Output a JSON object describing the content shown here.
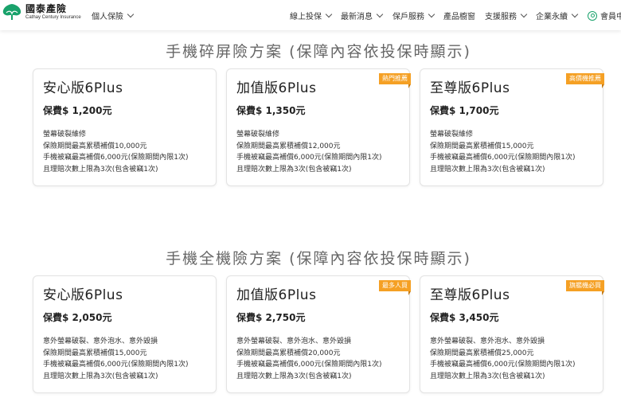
{
  "brand": {
    "name_cn": "國泰產險",
    "name_en": "Cathay Century Insurance",
    "primary_color": "#19a26b",
    "badge_color": "#f5a024"
  },
  "nav": {
    "personal": "個人保險",
    "items": [
      "線上投保",
      "最新消息",
      "保戶服務",
      "產品櫥窗",
      "支援服務",
      "企業永續"
    ],
    "member": "會員中心"
  },
  "sections": [
    {
      "title": "手機碎屏險方案 (保障內容依投保時顯示)",
      "plans": [
        {
          "name": "安心版6Plus",
          "badge": "",
          "price": "保費$ 1,200元",
          "lines": [
            "螢幕破裂維修",
            "保險期間最高累積補償10,000元",
            "手機被竊最高補償6,000元(保險期間內限1次)",
            "且理賠次數上限為3次(包含被竊1次)"
          ]
        },
        {
          "name": "加值版6Plus",
          "badge": "熱門推薦",
          "price": "保費$ 1,350元",
          "lines": [
            "螢幕破裂維修",
            "保險期間最高累積補償12,000元",
            "手機被竊最高補償6,000元(保險期間內限1次)",
            "且理賠次數上限為3次(包含被竊1次)"
          ]
        },
        {
          "name": "至尊版6Plus",
          "badge": "高價機推薦",
          "price": "保費$ 1,700元",
          "lines": [
            "螢幕破裂維修",
            "保險期間最高累積補償15,000元",
            "手機被竊最高補償6,000元(保險期間內限1次)",
            "且理賠次數上限為3次(包含被竊1次)"
          ]
        }
      ]
    },
    {
      "title": "手機全機險方案 (保障內容依投保時顯示)",
      "plans": [
        {
          "name": "安心版6Plus",
          "badge": "",
          "price": "保費$ 2,050元",
          "lines": [
            "意外螢幕破裂、意外泡水、意外毀損",
            "保險期間最高累積補償15,000元",
            "手機被竊最高補償6,000元(保險期間內限1次)",
            "且理賠次數上限為3次(包含被竊1次)"
          ]
        },
        {
          "name": "加值版6Plus",
          "badge": "最多人買",
          "price": "保費$ 2,750元",
          "lines": [
            "意外螢幕破裂、意外泡水、意外毀損",
            "保險期間最高累積補償20,000元",
            "手機被竊最高補償6,000元(保險期間內限1次)",
            "且理賠次數上限為3次(包含被竊1次)"
          ]
        },
        {
          "name": "至尊版6Plus",
          "badge": "旗艦機必買",
          "price": "保費$ 3,450元",
          "lines": [
            "意外螢幕破裂、意外泡水、意外毀損",
            "保險期間最高累積補償25,000元",
            "手機被竊最高補償6,000元(保險期間內限1次)",
            "且理賠次數上限為3次(包含被竊1次)"
          ]
        }
      ]
    }
  ]
}
